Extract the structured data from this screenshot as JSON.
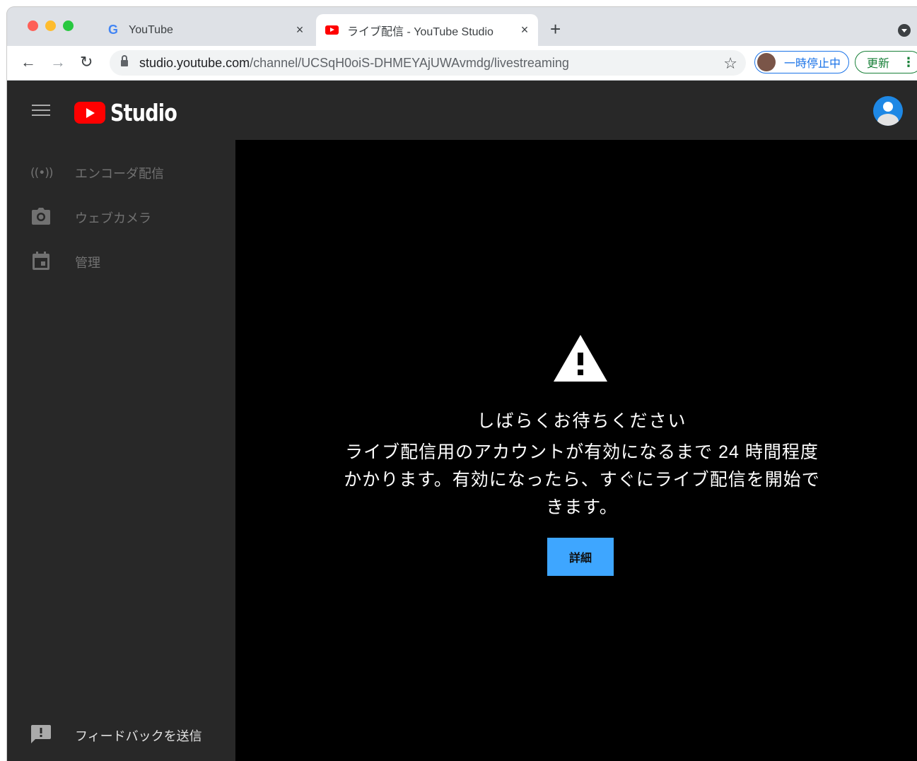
{
  "browser": {
    "tabs": [
      {
        "title": "YouTube",
        "favicon": "google-g-icon",
        "active": false
      },
      {
        "title": "ライブ配信 - YouTube Studio",
        "favicon": "youtube-favicon-icon",
        "active": true
      }
    ],
    "close_glyph": "×",
    "new_tab_glyph": "+",
    "url_host": "studio.youtube.com",
    "url_path": "/channel/UCSqH0oiS-DHMEYAjUWAvmdg/livestreaming",
    "profile_status": "一時停止中",
    "update_label": "更新",
    "menu_glyph": "⋮",
    "back_glyph": "←",
    "forward_glyph": "→",
    "reload_glyph": "↻",
    "star_glyph": "☆"
  },
  "studio": {
    "logo_text": "Studio",
    "sidebar": {
      "items": [
        {
          "label": "エンコーダ配信",
          "icon": "live-broadcast-icon",
          "icon_glyph": "((•))"
        },
        {
          "label": "ウェブカメラ",
          "icon": "camera-icon"
        },
        {
          "label": "管理",
          "icon": "calendar-icon"
        }
      ],
      "feedback_label": "フィードバックを送信"
    },
    "main": {
      "title": "しばらくお待ちください",
      "message": "ライブ配信用のアカウントが有効になるまで 24 時間程度かかります。有効になったら、すぐにライブ配信を開始できます。",
      "button_label": "詳細"
    }
  },
  "colors": {
    "header_bg": "#282828",
    "main_bg": "#000000",
    "button_blue": "#3ea6ff",
    "youtube_red": "#ff0000"
  }
}
